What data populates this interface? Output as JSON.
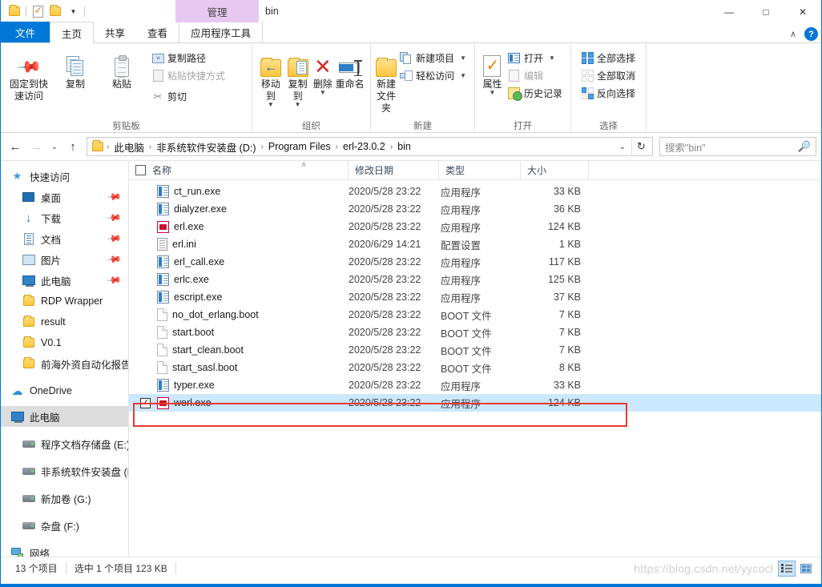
{
  "window": {
    "title": "bin",
    "quick_access": [
      "folder-icon",
      "properties-icon",
      "new-folder-icon",
      "customize-dropdown-icon"
    ],
    "controls": {
      "minimize": "—",
      "maximize": "□",
      "close": "✕"
    },
    "contextual_tab_group": "管理",
    "collapse_ribbon": "∧",
    "help": "?"
  },
  "tabs": [
    {
      "label": "文件",
      "kind": "file"
    },
    {
      "label": "主页",
      "kind": "active"
    },
    {
      "label": "共享",
      "kind": "normal"
    },
    {
      "label": "查看",
      "kind": "normal"
    },
    {
      "label": "应用程序工具",
      "kind": "contextual"
    }
  ],
  "ribbon": {
    "groups": [
      {
        "label": "剪贴板",
        "big_buttons": [
          {
            "label": "固定到快\n速访问",
            "line1": "固定到快",
            "line2": "速访问",
            "icon": "pin-icon"
          },
          {
            "label": "复制",
            "line1": "复制",
            "line2": "",
            "icon": "copy-icon"
          },
          {
            "label": "粘贴",
            "line1": "粘贴",
            "line2": "",
            "icon": "paste-icon"
          }
        ],
        "small_buttons": [
          {
            "label": "复制路径",
            "icon": "copy-path-icon",
            "disabled": false,
            "caret": false
          },
          {
            "label": "粘贴快捷方式",
            "icon": "paste-shortcut-icon",
            "disabled": true,
            "caret": false
          },
          {
            "label": "剪切",
            "icon": "cut-icon",
            "disabled": false,
            "caret": false
          }
        ]
      },
      {
        "label": "组织",
        "big_buttons": [
          {
            "line1": "移动到",
            "line2": "",
            "icon": "move-to-icon",
            "caret": true
          },
          {
            "line1": "复制到",
            "line2": "",
            "icon": "copy-to-icon",
            "caret": true
          },
          {
            "line1": "删除",
            "line2": "",
            "icon": "delete-icon",
            "caret": true
          },
          {
            "line1": "重命名",
            "line2": "",
            "icon": "rename-icon",
            "caret": false
          }
        ],
        "small_buttons": []
      },
      {
        "label": "新建",
        "big_buttons": [
          {
            "line1": "新建",
            "line2": "文件夹",
            "icon": "new-folder-icon",
            "caret": false
          }
        ],
        "small_buttons": [
          {
            "label": "新建项目",
            "icon": "new-item-icon",
            "disabled": false,
            "caret": true
          },
          {
            "label": "轻松访问",
            "icon": "easy-access-icon",
            "disabled": false,
            "caret": true
          }
        ]
      },
      {
        "label": "打开",
        "big_buttons": [
          {
            "line1": "属性",
            "line2": "",
            "icon": "properties-icon",
            "caret": true
          }
        ],
        "small_buttons": [
          {
            "label": "打开",
            "icon": "open-icon",
            "disabled": false,
            "caret": true
          },
          {
            "label": "编辑",
            "icon": "edit-icon",
            "disabled": true,
            "caret": false
          },
          {
            "label": "历史记录",
            "icon": "history-icon",
            "disabled": false,
            "caret": false
          }
        ]
      },
      {
        "label": "选择",
        "big_buttons": [],
        "small_buttons": [
          {
            "label": "全部选择",
            "icon": "select-all-icon",
            "disabled": false,
            "caret": false
          },
          {
            "label": "全部取消",
            "icon": "select-none-icon",
            "disabled": false,
            "caret": false
          },
          {
            "label": "反向选择",
            "icon": "invert-selection-icon",
            "disabled": false,
            "caret": false
          }
        ]
      }
    ]
  },
  "address": {
    "back": "←",
    "forward": "→",
    "recent": "⌄",
    "up": "↑",
    "breadcrumbs": [
      "此电脑",
      "非系统软件安装盘 (D:)",
      "Program Files",
      "erl-23.0.2",
      "bin"
    ],
    "separator": "›",
    "dropdown": "⌄",
    "refresh": "↻"
  },
  "search": {
    "placeholder": "搜索\"bin\"",
    "icon": "search-icon"
  },
  "nav_pane": {
    "items": [
      {
        "label": "快速访问",
        "icon": "star-icon",
        "indent": 0,
        "pinned": false,
        "selected": false
      },
      {
        "label": "桌面",
        "icon": "desktop-icon",
        "indent": 1,
        "pinned": true,
        "selected": false
      },
      {
        "label": "下载",
        "icon": "downloads-icon",
        "indent": 1,
        "pinned": true,
        "selected": false
      },
      {
        "label": "文档",
        "icon": "documents-icon",
        "indent": 1,
        "pinned": true,
        "selected": false
      },
      {
        "label": "图片",
        "icon": "pictures-icon",
        "indent": 1,
        "pinned": true,
        "selected": false
      },
      {
        "label": "此电脑",
        "icon": "this-pc-icon",
        "indent": 1,
        "pinned": true,
        "selected": false
      },
      {
        "label": "RDP Wrapper",
        "icon": "folder-icon",
        "indent": 1,
        "pinned": false,
        "selected": false
      },
      {
        "label": "result",
        "icon": "folder-icon",
        "indent": 1,
        "pinned": false,
        "selected": false
      },
      {
        "label": "V0.1",
        "icon": "folder-icon",
        "indent": 1,
        "pinned": false,
        "selected": false
      },
      {
        "label": "前海外资自动化报告",
        "icon": "folder-icon",
        "indent": 1,
        "pinned": false,
        "selected": false
      },
      {
        "label": "OneDrive",
        "icon": "onedrive-icon",
        "indent": 0,
        "pinned": false,
        "selected": false
      },
      {
        "label": "此电脑",
        "icon": "this-pc-icon",
        "indent": 0,
        "pinned": false,
        "selected": true
      },
      {
        "label": "程序文档存储盘 (E:)",
        "icon": "drive-icon",
        "indent": 1,
        "pinned": false,
        "selected": false
      },
      {
        "label": "非系统软件安装盘 (D:)",
        "icon": "drive-icon",
        "indent": 1,
        "pinned": false,
        "selected": false
      },
      {
        "label": "新加卷 (G:)",
        "icon": "drive-icon",
        "indent": 1,
        "pinned": false,
        "selected": false
      },
      {
        "label": "杂盘 (F:)",
        "icon": "drive-icon",
        "indent": 1,
        "pinned": false,
        "selected": false
      },
      {
        "label": "网络",
        "icon": "network-icon",
        "indent": 0,
        "pinned": false,
        "selected": false
      }
    ]
  },
  "file_list": {
    "columns": [
      "名称",
      "修改日期",
      "类型",
      "大小"
    ],
    "sort_indicator": "∧",
    "rows": [
      {
        "name": "ct_run.exe",
        "date": "2020/5/28 23:22",
        "type": "应用程序",
        "size": "33 KB",
        "icon": "exe-icon",
        "selected": false,
        "checked": false
      },
      {
        "name": "dialyzer.exe",
        "date": "2020/5/28 23:22",
        "type": "应用程序",
        "size": "36 KB",
        "icon": "exe-icon",
        "selected": false,
        "checked": false
      },
      {
        "name": "erl.exe",
        "date": "2020/5/28 23:22",
        "type": "应用程序",
        "size": "124 KB",
        "icon": "erlang-icon",
        "selected": false,
        "checked": false
      },
      {
        "name": "erl.ini",
        "date": "2020/6/29 14:21",
        "type": "配置设置",
        "size": "1 KB",
        "icon": "ini-icon",
        "selected": false,
        "checked": false
      },
      {
        "name": "erl_call.exe",
        "date": "2020/5/28 23:22",
        "type": "应用程序",
        "size": "117 KB",
        "icon": "exe-icon",
        "selected": false,
        "checked": false
      },
      {
        "name": "erlc.exe",
        "date": "2020/5/28 23:22",
        "type": "应用程序",
        "size": "125 KB",
        "icon": "exe-icon",
        "selected": false,
        "checked": false
      },
      {
        "name": "escript.exe",
        "date": "2020/5/28 23:22",
        "type": "应用程序",
        "size": "37 KB",
        "icon": "exe-icon",
        "selected": false,
        "checked": false
      },
      {
        "name": "no_dot_erlang.boot",
        "date": "2020/5/28 23:22",
        "type": "BOOT 文件",
        "size": "7 KB",
        "icon": "boot-icon",
        "selected": false,
        "checked": false
      },
      {
        "name": "start.boot",
        "date": "2020/5/28 23:22",
        "type": "BOOT 文件",
        "size": "7 KB",
        "icon": "boot-icon",
        "selected": false,
        "checked": false
      },
      {
        "name": "start_clean.boot",
        "date": "2020/5/28 23:22",
        "type": "BOOT 文件",
        "size": "7 KB",
        "icon": "boot-icon",
        "selected": false,
        "checked": false
      },
      {
        "name": "start_sasl.boot",
        "date": "2020/5/28 23:22",
        "type": "BOOT 文件",
        "size": "8 KB",
        "icon": "boot-icon",
        "selected": false,
        "checked": false
      },
      {
        "name": "typer.exe",
        "date": "2020/5/28 23:22",
        "type": "应用程序",
        "size": "33 KB",
        "icon": "exe-icon",
        "selected": false,
        "checked": false
      },
      {
        "name": "werl.exe",
        "date": "2020/5/28 23:22",
        "type": "应用程序",
        "size": "124 KB",
        "icon": "erlang-icon",
        "selected": true,
        "checked": true
      }
    ],
    "checkmark": "✓",
    "annotation_color": "#e83b2e"
  },
  "status_bar": {
    "item_count": "13 个项目",
    "selection": "选中 1 个项目  123 KB",
    "watermark": "https://blog.csdn.net/yycocl",
    "view_buttons": [
      {
        "name": "details-view-button",
        "active": true
      },
      {
        "name": "large-icons-view-button",
        "active": false
      }
    ]
  }
}
